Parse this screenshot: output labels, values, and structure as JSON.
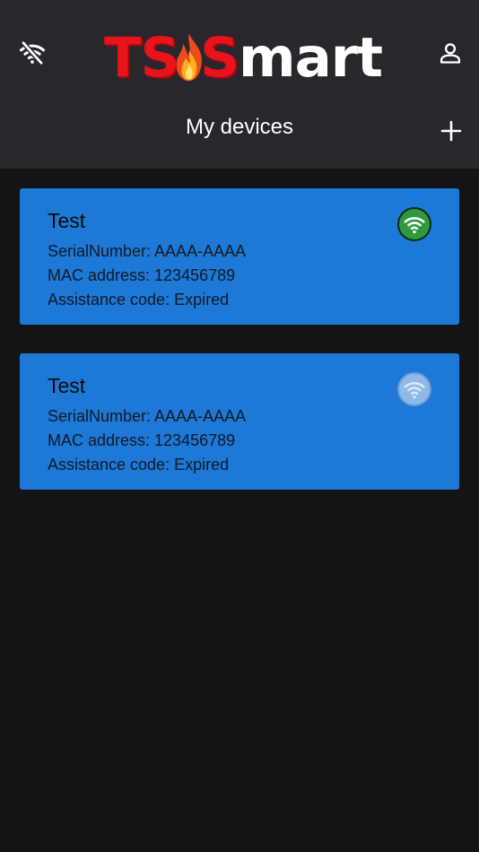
{
  "header": {
    "logo": {
      "part1": "TS",
      "part2": "S",
      "part3": "mart",
      "colors": {
        "red": "#e8131b",
        "white": "#ffffff"
      }
    },
    "title": "My devices",
    "icons": {
      "left": "wifi-off-icon",
      "right": "account-icon",
      "add": "plus-icon"
    }
  },
  "devices": [
    {
      "name": "Test",
      "serial_line": "SerialNumber: AAAA-AAAA",
      "mac_line": "MAC address: 123456789",
      "assistance_line": "Assistance code: Expired",
      "status": "online",
      "status_color": "#2e9a3d"
    },
    {
      "name": "Test",
      "serial_line": "SerialNumber: AAAA-AAAA",
      "mac_line": "MAC address: 123456789",
      "assistance_line": "Assistance code: Expired",
      "status": "offline",
      "status_color": "#8fb9e6"
    }
  ],
  "colors": {
    "header_bg": "#28272c",
    "page_bg": "#141414",
    "card_bg": "#1e78d6"
  }
}
